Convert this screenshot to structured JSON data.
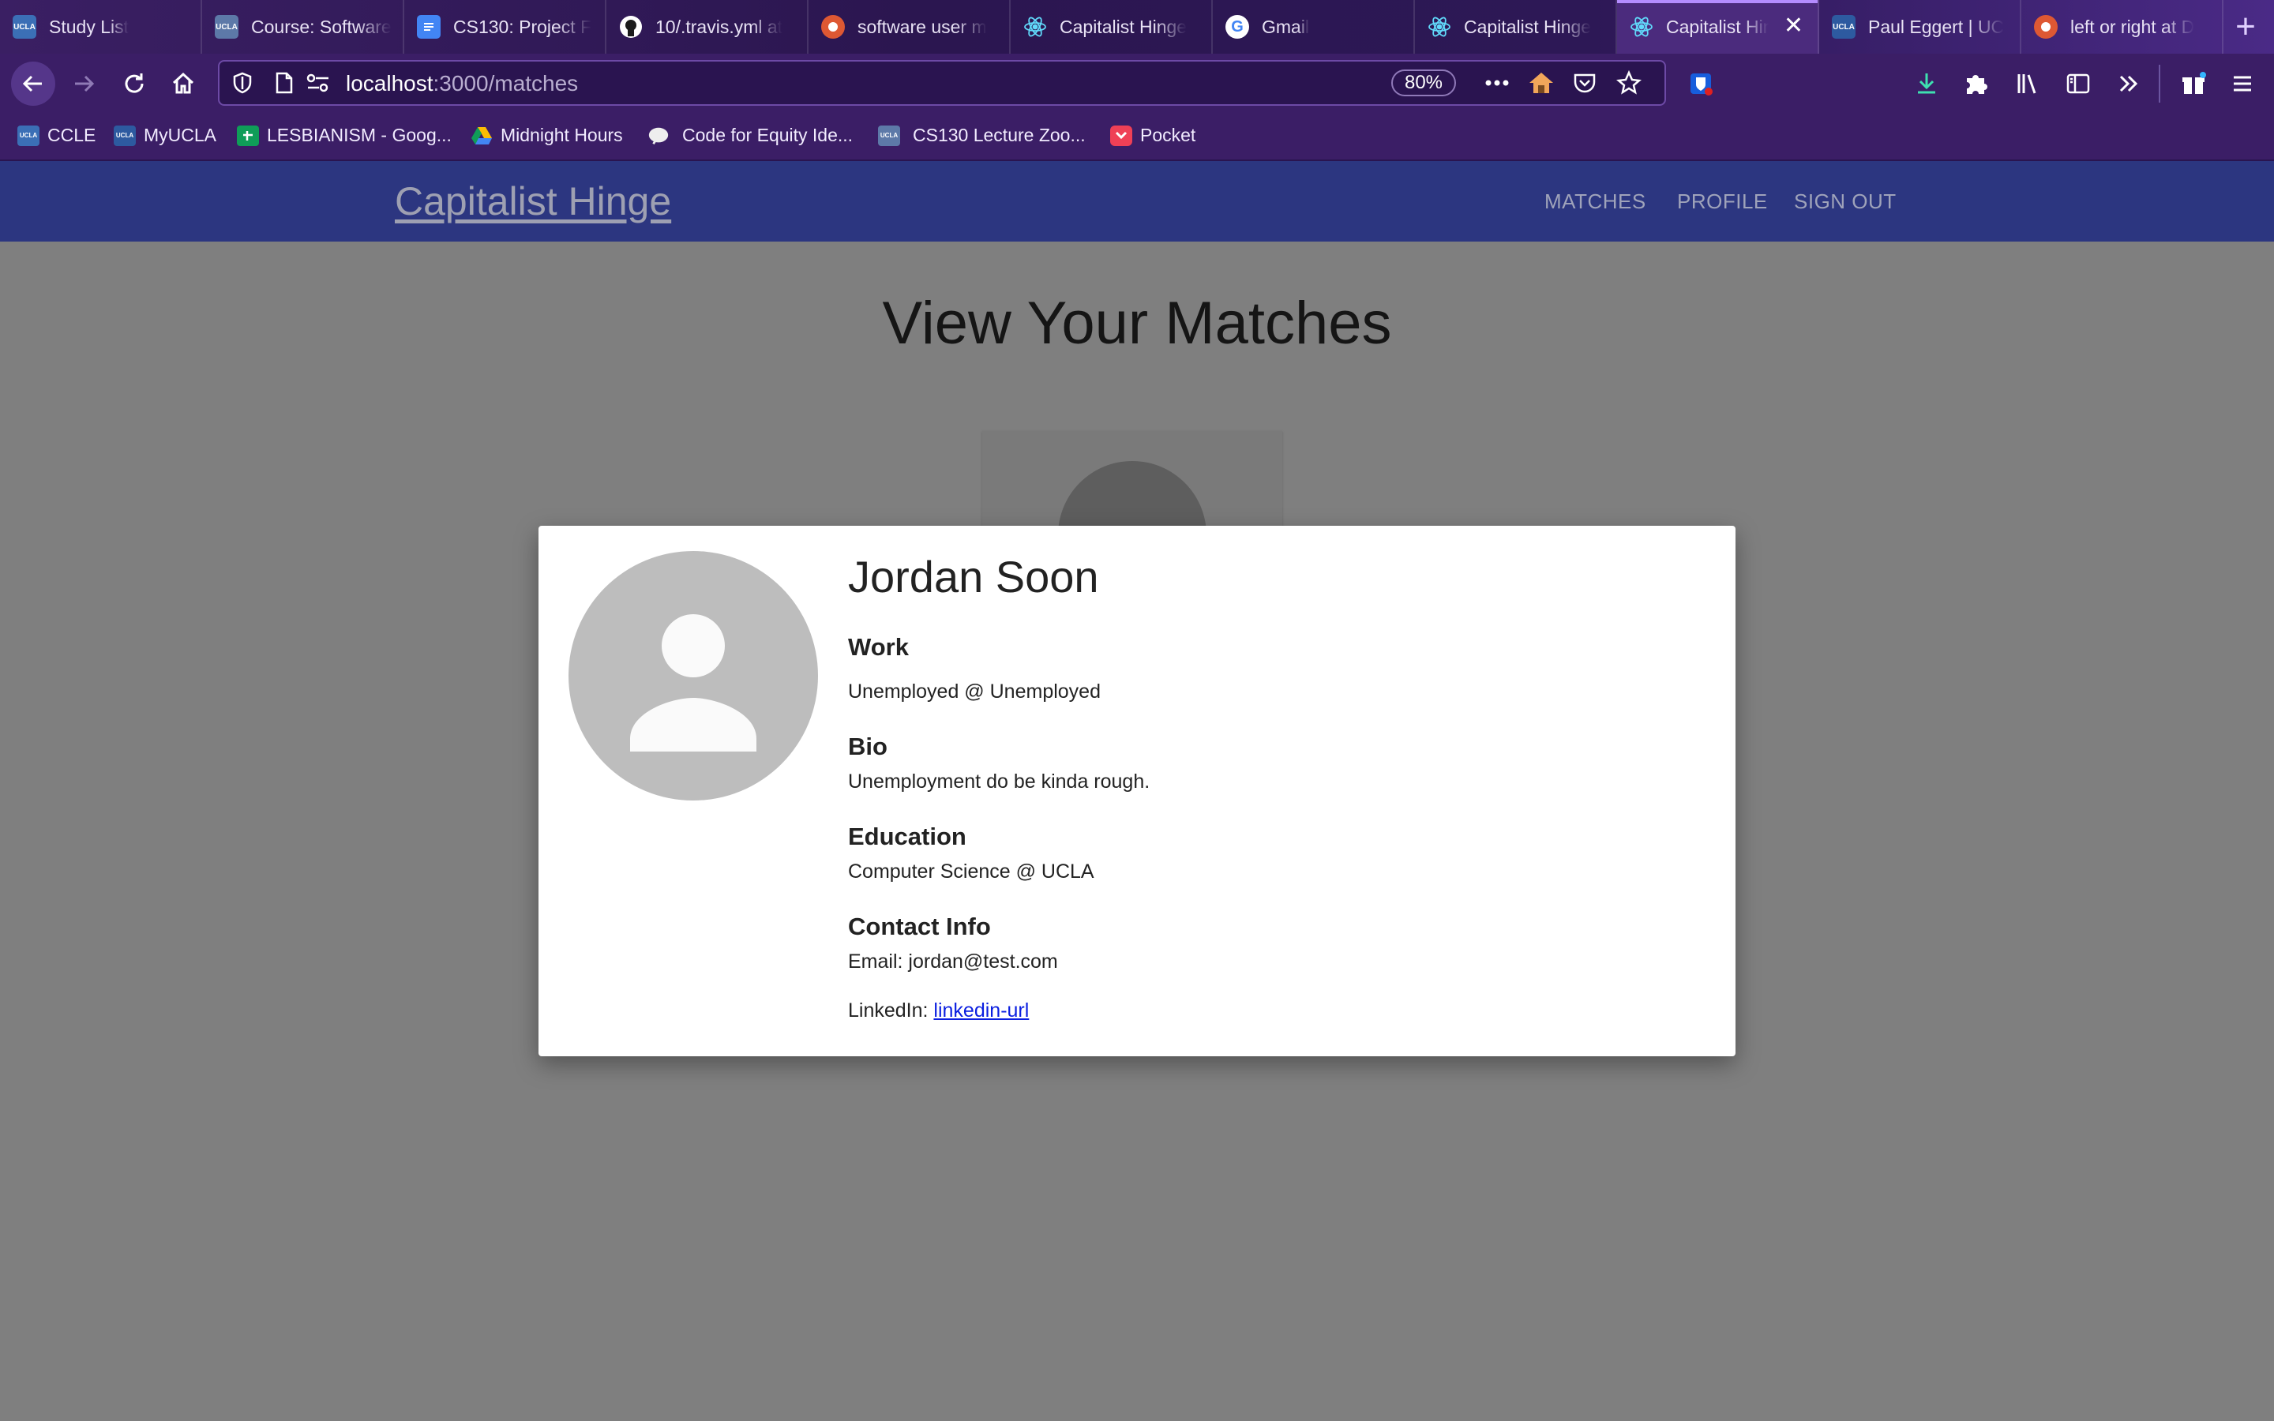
{
  "browser": {
    "tabs": [
      {
        "title": "Study List",
        "favicon": "ucla-icon",
        "color": "#3b6fb6"
      },
      {
        "title": "Course: Software",
        "favicon": "ucla-icon",
        "color": "#3b6fb6"
      },
      {
        "title": "CS130: Project F",
        "favicon": "docs-icon",
        "color": "#4285f4"
      },
      {
        "title": "10/.travis.yml at",
        "favicon": "github-icon",
        "color": "#1b1b1b"
      },
      {
        "title": "software user m",
        "favicon": "duckduckgo-icon",
        "color": "#de5833"
      },
      {
        "title": "Capitalist Hinge",
        "favicon": "react-icon",
        "color": "#61dafb"
      },
      {
        "title": "Gmail",
        "favicon": "google-icon",
        "color": "#ffffff"
      },
      {
        "title": "Capitalist Hinge",
        "favicon": "react-icon",
        "color": "#61dafb"
      },
      {
        "title": "Capitalist Hinge",
        "favicon": "react-icon",
        "color": "#61dafb",
        "active": true
      },
      {
        "title": "Paul Eggert | UC",
        "favicon": "ucla-icon",
        "color": "#3b6fb6"
      },
      {
        "title": "left or right at D",
        "favicon": "duckduckgo-icon",
        "color": "#de5833"
      }
    ],
    "url_host": "localhost",
    "url_path": ":3000/matches",
    "zoom": "80%",
    "bookmarks": [
      {
        "label": "CCLE",
        "favicon": "ucla-icon",
        "color": "#3b6fb6"
      },
      {
        "label": "MyUCLA",
        "favicon": "ucla-icon",
        "color": "#2d5aa0"
      },
      {
        "label": "LESBIANISM - Goog...",
        "favicon": "sheets-icon",
        "color": "#0f9d58"
      },
      {
        "label": "Midnight Hours",
        "favicon": "drive-icon",
        "color": "#fbbc04"
      },
      {
        "label": "Code for Equity Ide...",
        "favicon": "brain-icon",
        "color": "#eeeeee"
      },
      {
        "label": "CS130 Lecture Zoo...",
        "favicon": "ucla-icon",
        "color": "#3b6fb6"
      },
      {
        "label": "Pocket",
        "favicon": "pocket-icon",
        "color": "#ef4056"
      }
    ]
  },
  "app": {
    "brand": "Capitalist Hinge",
    "nav": {
      "matches": "MATCHES",
      "profile": "PROFILE",
      "sign_out": "SIGN OUT"
    },
    "page_title": "View Your Matches"
  },
  "modal": {
    "name": "Jordan Soon",
    "work_heading": "Work",
    "work_value": "Unemployed @ Unemployed",
    "bio_heading": "Bio",
    "bio_value": "Unemployment do be kinda rough.",
    "education_heading": "Education",
    "education_value": "Computer Science @ UCLA",
    "contact_heading": "Contact Info",
    "email_label": "Email: ",
    "email_value": "jordan@test.com",
    "linkedin_label": "LinkedIn: ",
    "linkedin_value": "linkedin-url"
  }
}
